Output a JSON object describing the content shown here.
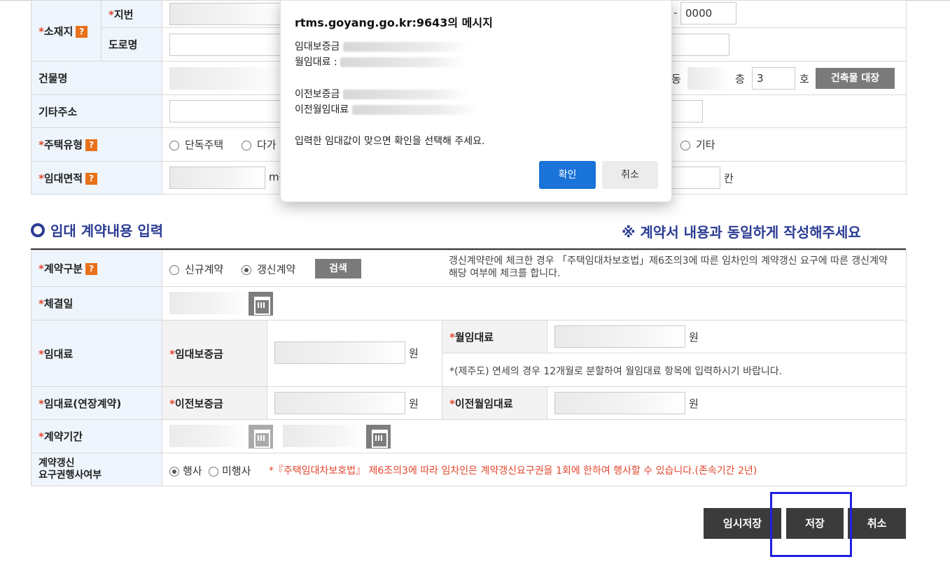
{
  "top_form": {
    "location_label": "소재지",
    "jibun_label": "지번",
    "road_label": "도로명",
    "jibun_sub_value": "0000",
    "building_label": "건물명",
    "dong_label": "동",
    "floor_label": "층",
    "floor_value": "3",
    "ho_label": "호",
    "building_ledger_button": "건축물 대장",
    "other_address_label": "기타주소",
    "house_type_label": "주택유형",
    "house_type_options": [
      "단독주택",
      "다가",
      "기타"
    ],
    "area_label": "임대면적",
    "area_unit": "m²",
    "area_unit2": "칸"
  },
  "section": {
    "title": "임대 계약내용 입력",
    "note": "※ 계약서 내용과 동일하게 작성해주세요"
  },
  "contract": {
    "type_label": "계약구분",
    "type_new": "신규계약",
    "type_renew": "갱신계약",
    "search_button": "검색",
    "type_note": "갱신계약란에 체크한 경우 「주택임대차보호법」제6조의3에 따른 임차인의 계약갱신 요구에 따른 갱신계약 해당 여부에 체크를 합니다.",
    "date_label": "체결일",
    "rent_label": "임대료",
    "deposit_label": "임대보증금",
    "monthly_label": "월임대료",
    "won": "원",
    "monthly_note": "*(제주도) 연세의 경우 12개월로 분할하여 월임대료 항목에 입력하시기 바랍니다.",
    "rent_ext_label": "임대료(연장계약)",
    "prev_deposit_label": "이전보증금",
    "prev_monthly_label": "이전월임대료",
    "period_label": "계약기간",
    "renewal_right_label_1": "계약갱신",
    "renewal_right_label_2": "요구권행사여부",
    "exercised": "행사",
    "not_exercised": "미행사",
    "renewal_note": "*『주택임대차보호법』 제6조의3에 따라 임차인은 계약갱신요구권을 1회에 한하여 행사할 수 있습니다.(존속기간 2년)"
  },
  "buttons": {
    "temp_save": "임시저장",
    "save": "저장",
    "cancel": "취소"
  },
  "dialog": {
    "title": "rtms.goyang.go.kr:9643의 메시지",
    "line_deposit": "임대보증금",
    "line_monthly": "월임대료 :",
    "line_prev_deposit": "이전보증금",
    "line_prev_monthly": "이전월임대료",
    "question": "입력한 임대값이 맞으면 확인을 선택해 주세요.",
    "ok": "확인",
    "cancel": "취소"
  },
  "colors": {
    "accent": "#2b3c93",
    "required": "#e2462c",
    "help": "#e8711b",
    "dialog_ok": "#1a73d9",
    "highlight": "#1f20e0"
  }
}
